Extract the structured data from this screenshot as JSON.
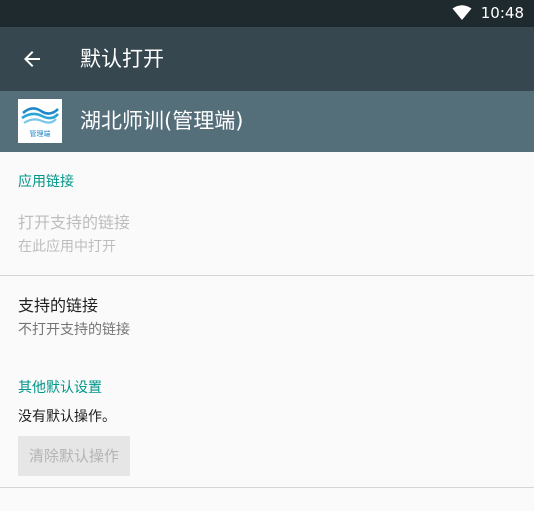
{
  "status_bar": {
    "time": "10:48"
  },
  "toolbar": {
    "title": "默认打开",
    "back_icon": "arrow-left-icon"
  },
  "app": {
    "name": "湖北师训(管理端)",
    "icon_text": "管理端"
  },
  "sections": {
    "app_links": {
      "header": "应用链接",
      "open_supported": {
        "title": "打开支持的链接",
        "subtitle": "在此应用中打开"
      },
      "supported_links": {
        "title": "支持的链接",
        "subtitle": "不打开支持的链接"
      }
    },
    "other_defaults": {
      "header": "其他默认设置",
      "status": "没有默认操作。",
      "clear_button": "清除默认操作"
    }
  },
  "colors": {
    "status_bar": "#1f2a2f",
    "toolbar": "#37474f",
    "app_header": "#546e7a",
    "accent": "#009688",
    "background": "#fafafa"
  }
}
